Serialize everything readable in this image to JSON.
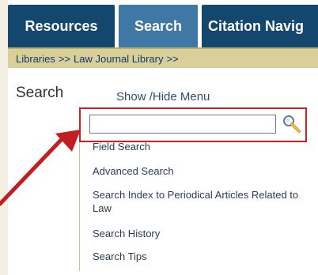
{
  "tabs": [
    {
      "label": "Resources"
    },
    {
      "label": "Search"
    },
    {
      "label": "Citation Navig"
    }
  ],
  "breadcrumb": {
    "items": [
      "Libraries",
      "Law Journal Library"
    ],
    "separator": ">>"
  },
  "title": "Search",
  "toggle_menu": "Show /Hide Menu",
  "search": {
    "value": "",
    "placeholder": ""
  },
  "menu": {
    "items": [
      "Field Search",
      "Advanced Search",
      "Search Index to Periodical Articles Related to Law",
      "Search History",
      "Search Tips"
    ]
  },
  "colors": {
    "tab_dark": "#14476e",
    "tab_active": "#3f77a5",
    "breadcrumb_bg": "#d8cf9b",
    "highlight": "#cc1f24"
  }
}
